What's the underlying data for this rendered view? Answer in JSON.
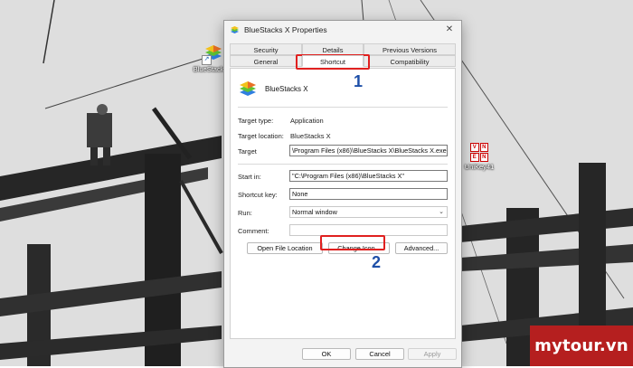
{
  "desktop": {
    "icons": [
      {
        "label": "BlueStacks X",
        "icon": "bluestacks-icon"
      },
      {
        "label": "UniKey41",
        "icon": "unikey-icon"
      }
    ]
  },
  "dialog": {
    "title": "BlueStacks X Properties",
    "close_label": "✕",
    "tabs_row1": [
      "Security",
      "Details",
      "Previous Versions"
    ],
    "tabs_row2": [
      "General",
      "Shortcut",
      "Compatibility"
    ],
    "active_tab": "Shortcut",
    "app_name": "BlueStacks X",
    "fields": {
      "target_type_label": "Target type:",
      "target_type_value": "Application",
      "target_location_label": "Target location:",
      "target_location_value": "BlueStacks X",
      "target_label": "Target",
      "target_value": "\\Program Files (x86)\\BlueStacks X\\BlueStacks X.exe\"",
      "start_in_label": "Start in:",
      "start_in_value": "\"C:\\Program Files (x86)\\BlueStacks X\"",
      "shortcut_key_label": "Shortcut key:",
      "shortcut_key_value": "None",
      "run_label": "Run:",
      "run_value": "Normal window",
      "comment_label": "Comment:",
      "comment_value": ""
    },
    "buttons": {
      "open_file_location": "Open File Location",
      "change_icon": "Change Icon...",
      "advanced": "Advanced..."
    },
    "footer": {
      "ok": "OK",
      "cancel": "Cancel",
      "apply": "Apply"
    }
  },
  "annotations": {
    "step1": "1",
    "step2": "2",
    "highlight_color": "#e0201f",
    "number_color": "#1e4fa8"
  },
  "watermark": {
    "text": "mytour.vn",
    "color": "#b51f1f"
  }
}
